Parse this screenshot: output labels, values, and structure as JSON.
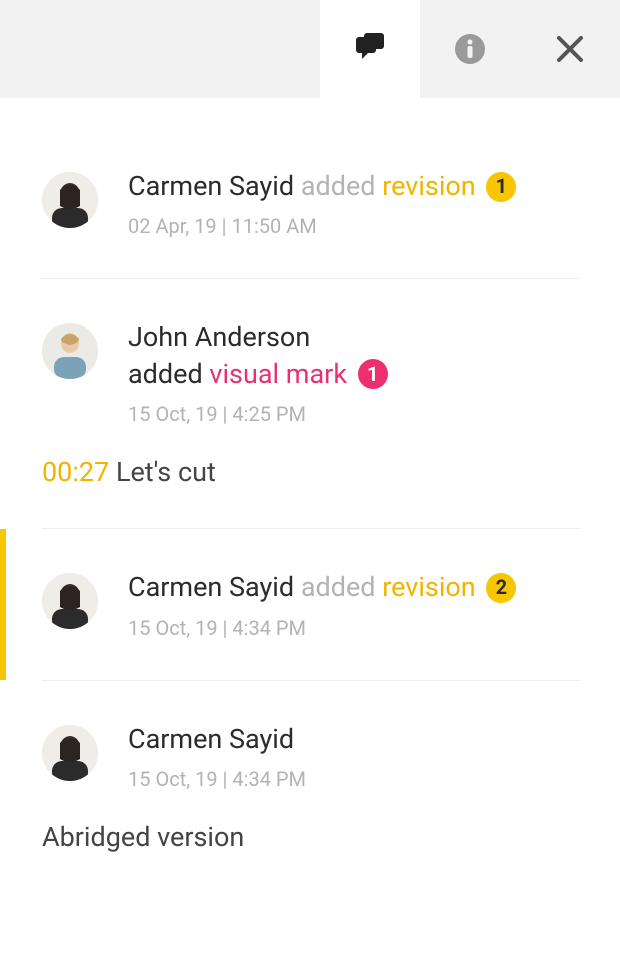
{
  "entries": [
    {
      "user": "Carmen Sayid",
      "action": "added",
      "actionStyle": "grey",
      "kind": "revision",
      "kindStyle": "yellow",
      "badge": "1",
      "badgeStyle": "yellow",
      "timestamp": "02 Apr, 19 | 11:50 AM"
    },
    {
      "user": "John Anderson",
      "action": "added",
      "actionStyle": "dark",
      "kind": "visual mark",
      "kindStyle": "pink",
      "badge": "1",
      "badgeStyle": "pink",
      "timestamp": "15 Oct, 19 | 4:25 PM",
      "noteTimecode": "00:27",
      "noteText": "Let's cut"
    },
    {
      "user": "Carmen Sayid",
      "action": "added",
      "actionStyle": "grey",
      "kind": "revision",
      "kindStyle": "yellow",
      "badge": "2",
      "badgeStyle": "yellow",
      "timestamp": "15 Oct, 19 | 4:34 PM"
    },
    {
      "user": "Carmen Sayid",
      "timestamp": "15 Oct, 19 | 4:34 PM",
      "comment": "Abridged version"
    }
  ]
}
